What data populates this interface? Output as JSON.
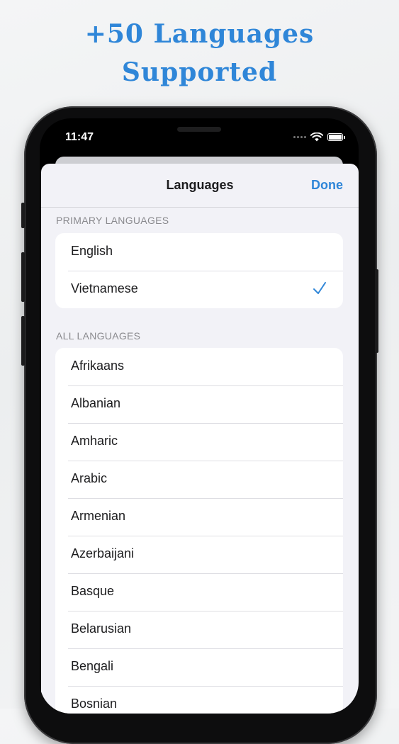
{
  "headline": {
    "line1": "+50 Languages",
    "line2": "Supported"
  },
  "status_bar": {
    "time": "11:47"
  },
  "sheet": {
    "title": "Languages",
    "done_label": "Done",
    "primary_header": "PRIMARY LANGUAGES",
    "primary_items": [
      {
        "label": "English",
        "selected": false
      },
      {
        "label": "Vietnamese",
        "selected": true
      }
    ],
    "all_header": "ALL LANGUAGES",
    "all_items": [
      "Afrikaans",
      "Albanian",
      "Amharic",
      "Arabic",
      "Armenian",
      "Azerbaijani",
      "Basque",
      "Belarusian",
      "Bengali",
      "Bosnian"
    ]
  },
  "colors": {
    "accent": "#2f86d8",
    "background": "#f2f2f7"
  }
}
